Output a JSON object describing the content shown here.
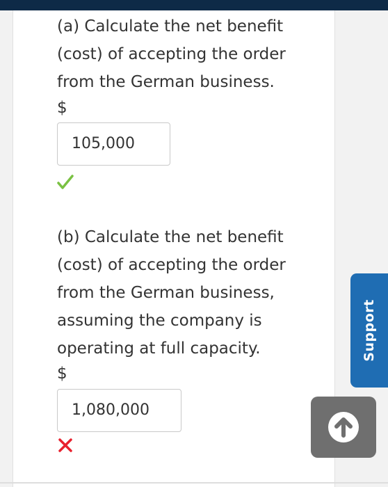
{
  "question_a": {
    "prompt": "(a) Calculate the net benefit (cost) of accepting the order from the German business.",
    "currency": "$",
    "answer": "105,000",
    "status": "correct"
  },
  "question_b": {
    "prompt": "(b) Calculate the net benefit (cost) of accepting the order from the German business, assuming the company is operating at full capacity.",
    "currency": "$",
    "answer": "1,080,000",
    "status": "incorrect"
  },
  "support_tab": {
    "label": "Support"
  },
  "icons": {
    "correct": "check-icon",
    "incorrect": "x-icon",
    "scroll_top": "arrow-up-icon"
  },
  "colors": {
    "correct": "#7ac143",
    "incorrect": "#e8212e",
    "support": "#1f6db3",
    "header": "#0e2a47"
  }
}
